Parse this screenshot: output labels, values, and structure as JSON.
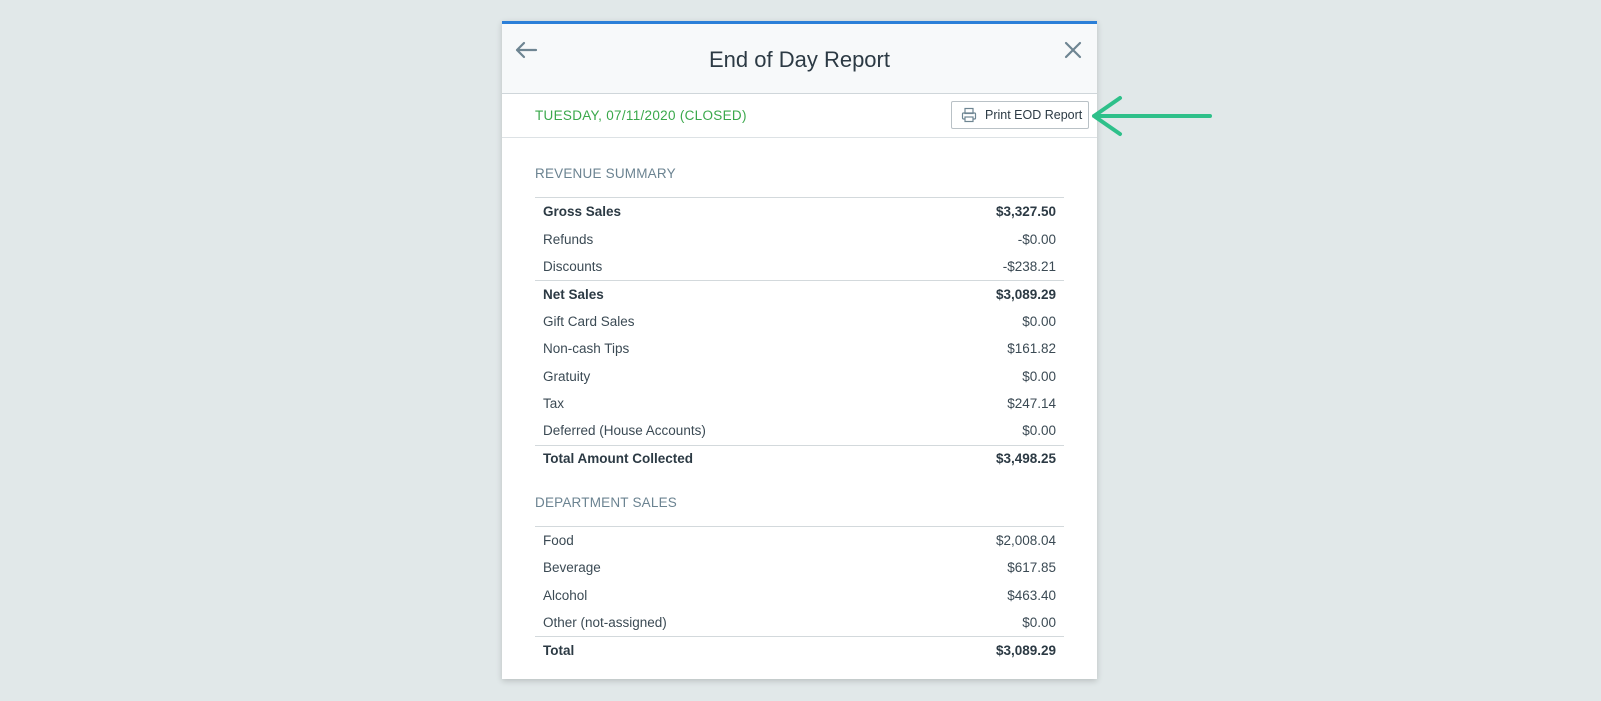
{
  "modal": {
    "title": "End of Day Report",
    "date_status": "TUESDAY, 07/11/2020 (CLOSED)",
    "print_button": "Print EOD Report"
  },
  "revenue_summary": {
    "title": "REVENUE SUMMARY",
    "rows": [
      {
        "label": "Gross Sales",
        "value": "$3,327.50"
      },
      {
        "label": "Refunds",
        "value": "-$0.00"
      },
      {
        "label": "Discounts",
        "value": "-$238.21"
      },
      {
        "label": "Net Sales",
        "value": "$3,089.29"
      },
      {
        "label": "Gift Card Sales",
        "value": "$0.00"
      },
      {
        "label": "Non-cash Tips",
        "value": "$161.82"
      },
      {
        "label": "Gratuity",
        "value": "$0.00"
      },
      {
        "label": "Tax",
        "value": "$247.14"
      },
      {
        "label": "Deferred (House Accounts)",
        "value": "$0.00"
      },
      {
        "label": "Total Amount Collected",
        "value": "$3,498.25"
      }
    ]
  },
  "department_sales": {
    "title": "DEPARTMENT SALES",
    "rows": [
      {
        "label": "Food",
        "value": "$2,008.04"
      },
      {
        "label": "Beverage",
        "value": "$617.85"
      },
      {
        "label": "Alcohol",
        "value": "$463.40"
      },
      {
        "label": "Other (not-assigned)",
        "value": "$0.00"
      },
      {
        "label": "Total",
        "value": "$3,089.29"
      }
    ]
  },
  "colors": {
    "accent_top_border": "#2b7fd8",
    "date_status": "#3aa84b",
    "annotation_arrow": "#2ec08a",
    "background": "#e1e8e9"
  },
  "icons": {
    "back": "arrow-left-icon",
    "close": "close-icon",
    "print": "printer-icon",
    "annotation": "arrow-left-annotation"
  }
}
